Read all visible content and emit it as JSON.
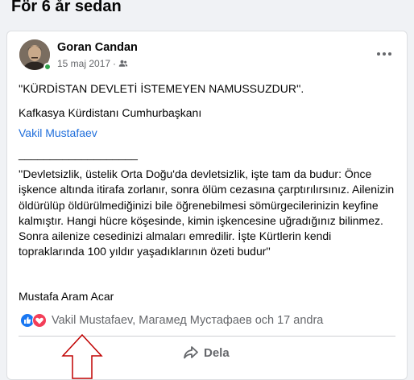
{
  "section": {
    "title": "För 6 år sedan"
  },
  "post": {
    "author": "Goran Candan",
    "date": "15 maj 2017",
    "separator": "·",
    "audience_icon": "friends-icon",
    "line1": "''KÜRDİSTAN DEVLETİ İSTEMEYEN NAMUSSUZDUR''.",
    "line2": "Kafkasya Kürdistanı Cumhurbaşkanı",
    "line3_link": "Vakil Mustafaev",
    "line4": "___________________",
    "quote": "''Devletsizlik, üstelik Orta Doğu'da devletsizlik, işte tam da budur: Önce işkence altında itirafa zorlanır, sonra ölüm cezasına çarptırılırsınız. Ailenizin öldürülüp öldürülmediğinizi bile öğrenebilmesi sömürgecilerinizin keyfine kalmıştır. Hangi hücre köşesinde, kimin işkencesine uğradığınız bilinmez. Sonra ailenize cesedinizi almaları emredilir. İşte Kürtlerin kendi topraklarında 100 yıldır yaşadıklarının özeti budur''",
    "signature": "Mustafa Aram Acar"
  },
  "reactions": {
    "icons": [
      "like-reaction-icon",
      "love-reaction-icon"
    ],
    "text": "Vakil Mustafaev, Магамед Мустафаев och 17 andra"
  },
  "actions": {
    "share_label": "Dela"
  },
  "colors": {
    "link": "#216fdb",
    "like": "#1877f2",
    "love": "#f33e58",
    "online": "#31a24c",
    "arrow": "#c00000"
  }
}
